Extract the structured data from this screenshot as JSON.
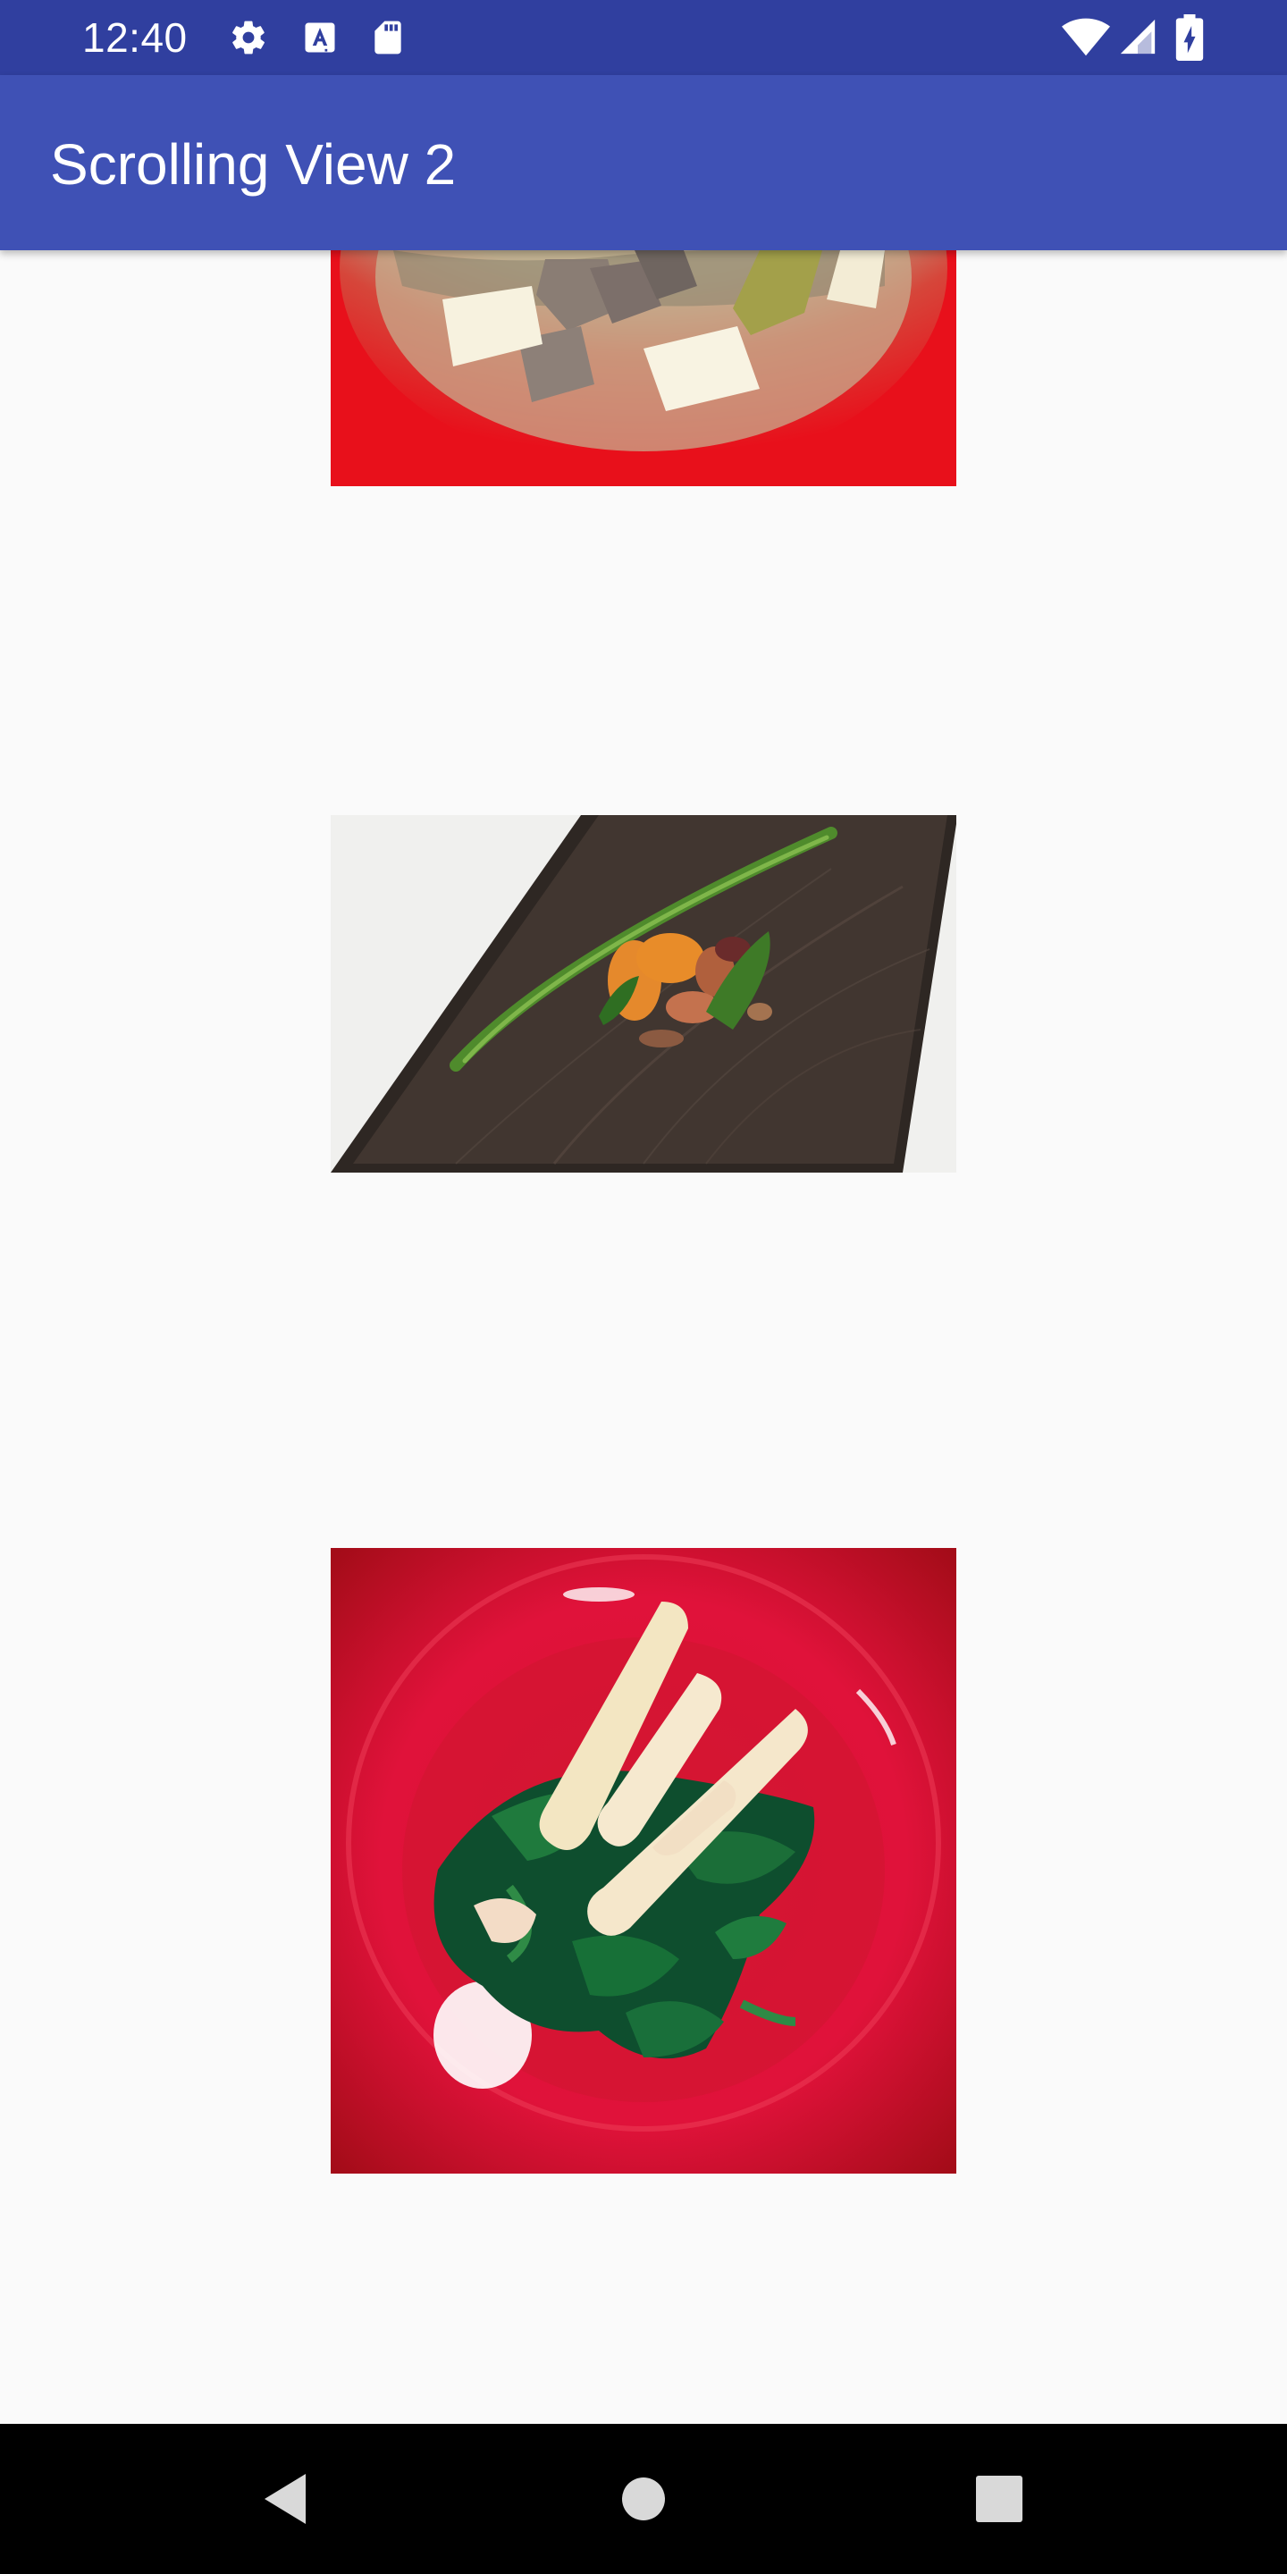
{
  "status_bar": {
    "time": "12:40",
    "icons_left": [
      "settings-icon",
      "text-a-icon",
      "sd-card-icon"
    ],
    "icons_right": [
      "wifi-icon",
      "signal-icon",
      "battery-charging-icon"
    ]
  },
  "app_bar": {
    "title": "Scrolling View 2"
  },
  "content": {
    "images": [
      {
        "name": "miso-soup-image",
        "subject": "miso soup with tofu in red bowl"
      },
      {
        "name": "mixed-beans-dish-image",
        "subject": "beans with green onion on dark wooden plate"
      },
      {
        "name": "spinach-squid-dish-image",
        "subject": "spinach with squid strips on red plate"
      }
    ]
  },
  "navigation": {
    "buttons": [
      "back-button",
      "home-button",
      "recents-button"
    ]
  },
  "colors": {
    "status_bar": "#303f9f",
    "app_bar": "#3f51b5",
    "background": "#fafafa",
    "nav_bar": "#000000"
  }
}
